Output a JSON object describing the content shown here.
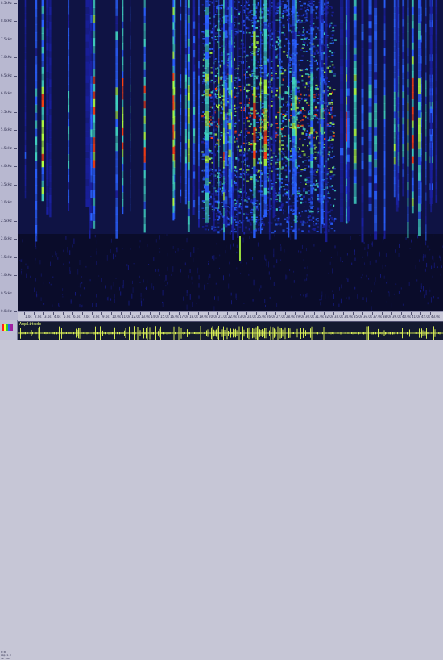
{
  "freq_axis": {
    "labels": [
      "8.5kHz",
      "8.0kHz",
      "7.5kHz",
      "7.0kHz",
      "6.5kHz",
      "6.0kHz",
      "5.5kHz",
      "5.0kHz",
      "4.5kHz",
      "4.0kHz",
      "3.5kHz",
      "3.0kHz",
      "2.5kHz",
      "2.0kHz",
      "1.5kHz",
      "1.0kHz",
      "0.5kHz",
      "0.0kHz"
    ]
  },
  "time_axis": {
    "labels": [
      "1.0s",
      "2.0s",
      "3.0s",
      "4.0s",
      "5.0s",
      "6.0s",
      "7.0s",
      "8.0s",
      "9.0s",
      "10.0s",
      "11.0s",
      "12.0s",
      "13.0s",
      "14.0s",
      "15.0s",
      "16.0s",
      "17.0s",
      "18.0s",
      "19.0s",
      "20.0s",
      "21.0s",
      "22.0s",
      "23.0s",
      "24.0s",
      "25.0s",
      "26.0s",
      "27.0s",
      "28.0s",
      "29.0s",
      "30.0s",
      "31.0s",
      "32.0s",
      "33.0s",
      "34.0s",
      "35.0s",
      "36.0s",
      "37.0s",
      "38.0s",
      "39.0s",
      "40.0s",
      "41.0s",
      "42.0s",
      "43.0s",
      "44.0s"
    ]
  },
  "waveform": {
    "label": "Amplitude"
  },
  "side_info": {
    "line1": "0:00",
    "line2": "Amp 1.0",
    "line3": "SR 16k"
  },
  "colors": {
    "background": "#0a0c2a",
    "low": "#1a20a0",
    "mid": "#2a60ff",
    "mid2": "#40d0c0",
    "high": "#b0ff40",
    "peak": "#ff4010",
    "waveform": "#e8ff5a"
  },
  "icons": {
    "colormap": "colormap-swatch-icon"
  }
}
